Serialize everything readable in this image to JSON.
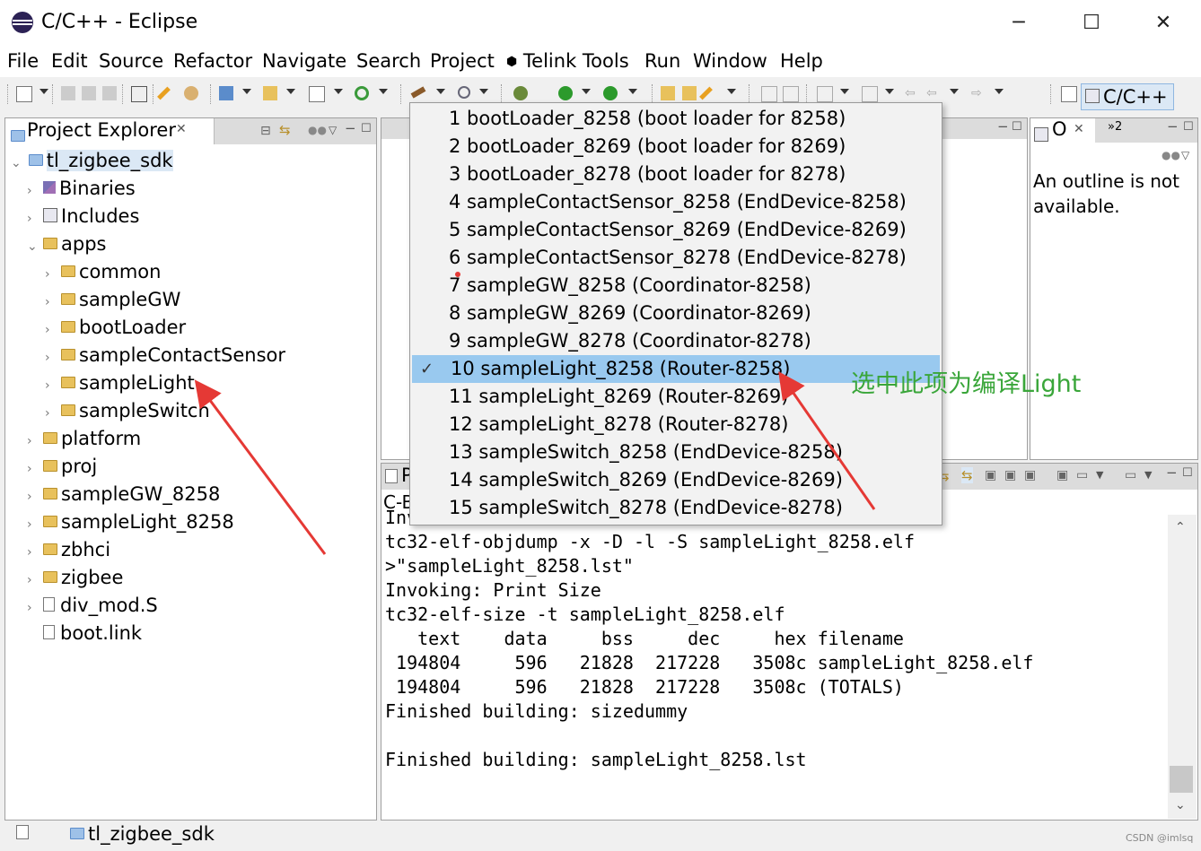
{
  "window": {
    "title": "C/C++ - Eclipse",
    "minimize": "─",
    "maximize": "☐",
    "close": "✕"
  },
  "menu": [
    "File",
    "Edit",
    "Source",
    "Refactor",
    "Navigate",
    "Search",
    "Project",
    "Telink Tools",
    "Run",
    "Window",
    "Help"
  ],
  "perspective": {
    "label": "C/C++"
  },
  "project_explorer": {
    "title": "Project Explorer",
    "root": "tl_zigbee_sdk",
    "items": [
      {
        "label": "Binaries",
        "level": 1,
        "icon": "binary-icon",
        "expander": "›"
      },
      {
        "label": "Includes",
        "level": 1,
        "icon": "includes-icon",
        "expander": "›"
      },
      {
        "label": "apps",
        "level": 1,
        "icon": "folder-icon",
        "expander": "⌄"
      },
      {
        "label": "common",
        "level": 2,
        "icon": "folder-icon",
        "expander": "›"
      },
      {
        "label": "sampleGW",
        "level": 2,
        "icon": "folder-icon",
        "expander": "›"
      },
      {
        "label": "bootLoader",
        "level": 2,
        "icon": "folder-icon",
        "expander": "›"
      },
      {
        "label": "sampleContactSensor",
        "level": 2,
        "icon": "folder-icon",
        "expander": "›"
      },
      {
        "label": "sampleLight",
        "level": 2,
        "icon": "folder-icon",
        "expander": "›"
      },
      {
        "label": "sampleSwitch",
        "level": 2,
        "icon": "folder-icon",
        "expander": "›"
      },
      {
        "label": "platform",
        "level": 1,
        "icon": "folder-icon",
        "expander": "›"
      },
      {
        "label": "proj",
        "level": 1,
        "icon": "folder-icon",
        "expander": "›"
      },
      {
        "label": "sampleGW_8258",
        "level": 1,
        "icon": "folder-icon",
        "expander": "›"
      },
      {
        "label": "sampleLight_8258",
        "level": 1,
        "icon": "folder-icon",
        "expander": "›"
      },
      {
        "label": "zbhci",
        "level": 1,
        "icon": "folder-icon",
        "expander": "›"
      },
      {
        "label": "zigbee",
        "level": 1,
        "icon": "folder-icon",
        "expander": "›"
      },
      {
        "label": "div_mod.S",
        "level": 1,
        "icon": "asm-file-icon",
        "expander": "›"
      },
      {
        "label": "boot.link",
        "level": 1,
        "icon": "file-icon",
        "expander": ""
      }
    ]
  },
  "build_configs": [
    "1 bootLoader_8258 (boot loader for 8258)",
    "2 bootLoader_8269 (boot loader for 8269)",
    "3 bootLoader_8278 (boot loader for 8278)",
    "4 sampleContactSensor_8258 (EndDevice-8258)",
    "5 sampleContactSensor_8269 (EndDevice-8269)",
    "6 sampleContactSensor_8278 (EndDevice-8278)",
    "7 sampleGW_8258 (Coordinator-8258)",
    "8 sampleGW_8269 (Coordinator-8269)",
    "9 sampleGW_8278 (Coordinator-8278)",
    "10 sampleLight_8258 (Router-8258)",
    "11 sampleLight_8269 (Router-8269)",
    "12 sampleLight_8278 (Router-8278)",
    "13 sampleSwitch_8258 (EndDevice-8258)",
    "14 sampleSwitch_8269 (EndDevice-8269)",
    "15 sampleSwitch_8278 (EndDevice-8278)"
  ],
  "selected_config_index": 9,
  "check_mark": "✓",
  "outline": {
    "tab": "O",
    "message": "An outline is not available.",
    "overflow": "»2"
  },
  "console": {
    "tab_partial": "P",
    "title_partial": "C-B",
    "lines": [
      "Inv",
      "tc32-elf-objdump -x -D -l -S sampleLight_8258.elf",
      ">\"sampleLight_8258.lst\"",
      "Invoking: Print Size",
      "tc32-elf-size -t sampleLight_8258.elf",
      "   text    data     bss     dec     hex filename",
      " 194804     596   21828  217228   3508c sampleLight_8258.elf",
      " 194804     596   21828  217228   3508c (TOTALS)",
      "Finished building: sizedummy",
      "",
      "Finished building: sampleLight_8258.lst"
    ]
  },
  "status_bar": {
    "project": "tl_zigbee_sdk",
    "watermark": "CSDN @imlsq"
  },
  "annotation": {
    "text": "选中此项为编译Light",
    "color": "#3aa63a",
    "arrow_color": "#e53935"
  }
}
